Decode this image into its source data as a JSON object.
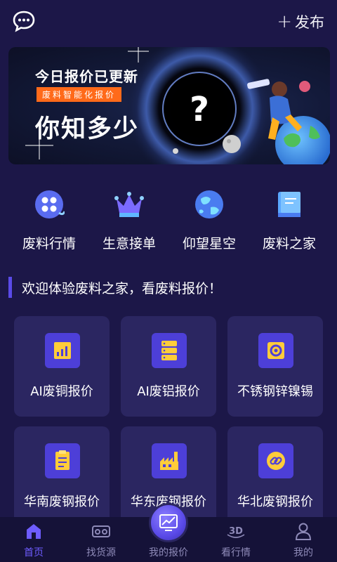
{
  "header": {
    "chat_icon": "chat-bubble-icon",
    "publish_label": "发布"
  },
  "banner": {
    "title": "今日报价已更新",
    "tag": "废料智能化报价",
    "headline": "你知多少"
  },
  "categories": [
    {
      "label": "废料行情",
      "icon": "film-reel-icon"
    },
    {
      "label": "生意接单",
      "icon": "crown-icon"
    },
    {
      "label": "仰望星空",
      "icon": "globe-icon"
    },
    {
      "label": "废料之家",
      "icon": "book-icon"
    }
  ],
  "section": {
    "title": "欢迎体验废料之家，看废料报价！"
  },
  "cards": [
    {
      "label": "AI废铜报价",
      "icon": "bar-chart-icon"
    },
    {
      "label": "AI废铝报价",
      "icon": "database-icon"
    },
    {
      "label": "不锈钢锌镍锡",
      "icon": "gear-icon"
    },
    {
      "label": "华南废钢报价",
      "icon": "clipboard-icon"
    },
    {
      "label": "华东废钢报价",
      "icon": "factory-icon"
    },
    {
      "label": "华北废钢报价",
      "icon": "link-icon"
    }
  ],
  "tabbar": {
    "tabs": [
      {
        "label": "首页",
        "icon": "home-icon",
        "active": true
      },
      {
        "label": "找货源",
        "icon": "vr-glasses-icon",
        "active": false
      },
      {
        "label": "我的报价",
        "icon": "trend-chart-icon",
        "active": false
      },
      {
        "label": "看行情",
        "icon": "3d-icon",
        "active": false
      },
      {
        "label": "我的",
        "icon": "user-icon",
        "active": false
      }
    ],
    "active_color": "#6e5cff",
    "inactive_color": "#8e8ab8"
  },
  "colors": {
    "background": "#1c1748",
    "card": "#2b2661",
    "accent": "#5a4ae8",
    "tag_orange": "#ff6a1a"
  }
}
